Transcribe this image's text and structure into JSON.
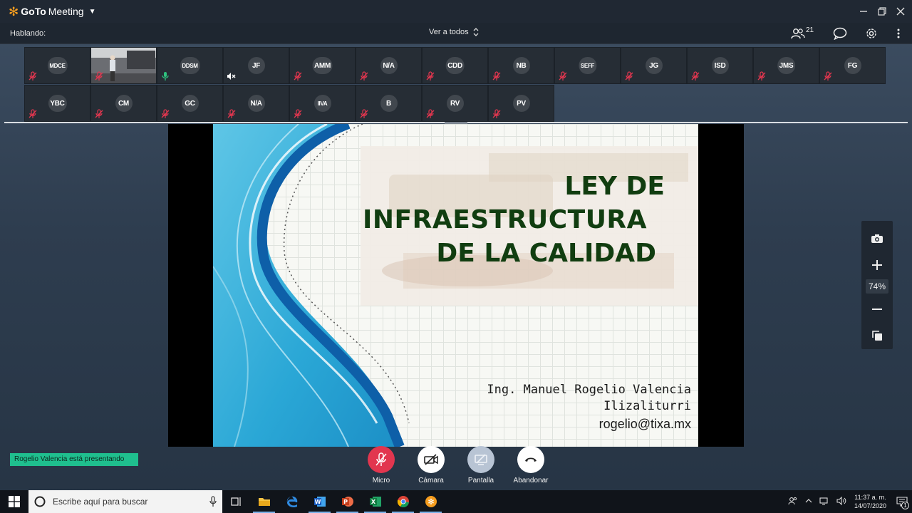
{
  "app": {
    "brand_bold": "GoTo",
    "brand_regular": "Meeting"
  },
  "toolbar": {
    "speaking_label": "Hablando:",
    "view_all_label": "Ver a todos",
    "participant_count": "21"
  },
  "participants_row1": [
    {
      "initials": "MDCE",
      "mic": "muted"
    },
    {
      "initials": "",
      "mic": "muted",
      "video": true
    },
    {
      "initials": "DDSM",
      "mic": "active"
    },
    {
      "initials": "JF",
      "mic": "speaker-off"
    },
    {
      "initials": "AMM",
      "mic": "muted"
    },
    {
      "initials": "N/A",
      "mic": "muted"
    },
    {
      "initials": "CDD",
      "mic": "muted"
    },
    {
      "initials": "NB",
      "mic": "muted"
    },
    {
      "initials": "SEFF",
      "mic": "muted"
    },
    {
      "initials": "JG",
      "mic": "muted"
    },
    {
      "initials": "ISD",
      "mic": "muted"
    },
    {
      "initials": "JMS",
      "mic": "muted"
    },
    {
      "initials": "FG",
      "mic": "muted"
    }
  ],
  "participants_row2": [
    {
      "initials": "YBC",
      "mic": "muted"
    },
    {
      "initials": "CM",
      "mic": "muted"
    },
    {
      "initials": "GC",
      "mic": "muted"
    },
    {
      "initials": "N/A",
      "mic": "muted"
    },
    {
      "initials": "IIVA",
      "mic": "muted"
    },
    {
      "initials": "B",
      "mic": "muted"
    },
    {
      "initials": "RV",
      "mic": "muted"
    },
    {
      "initials": "PV",
      "mic": "muted"
    }
  ],
  "slide": {
    "title_line1": "LEY DE",
    "title_line2": "INFRAESTRUCTURA",
    "title_line3": "DE LA CALIDAD",
    "author_line1": "Ing. Manuel Rogelio Valencia",
    "author_line2": "Ilizaliturri",
    "email": "rogelio@tixa.mx"
  },
  "zoom": {
    "level": "74%"
  },
  "presenting_banner": "Rogelio Valencia está presentando",
  "controls": {
    "mic_label": "Micro",
    "camera_label": "Cámara",
    "screen_label": "Pantalla",
    "leave_label": "Abandonar"
  },
  "taskbar": {
    "search_placeholder": "Escribe aquí para buscar",
    "time": "11:37 a. m.",
    "date": "14/07/2020",
    "notification_count": "1"
  },
  "colors": {
    "accent_orange": "#f59d1f",
    "muted_red": "#e2364f",
    "active_green": "#2ec27e",
    "banner_green": "#1fbf8e",
    "slide_title_green": "#113d10"
  }
}
